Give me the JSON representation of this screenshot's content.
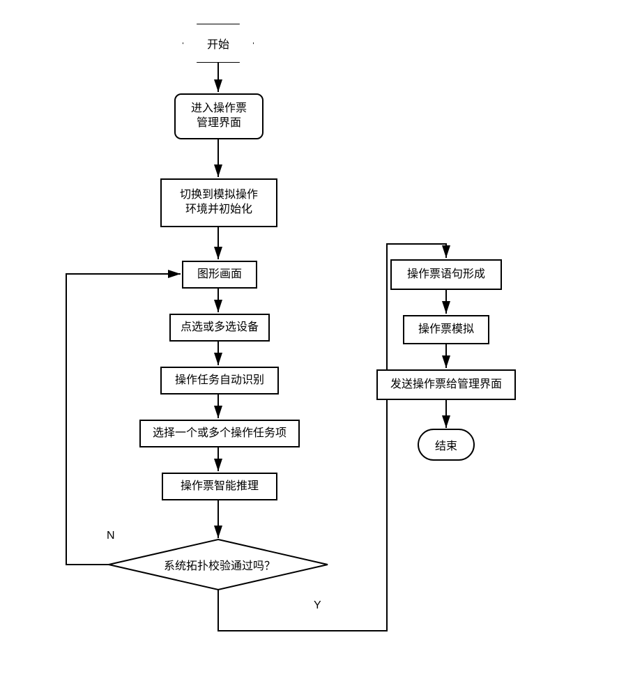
{
  "flow": {
    "start": "开始",
    "enter_mgmt": "进入操作票\n管理界面",
    "switch_sim": "切换到模拟操作\n环境并初始化",
    "graphic_screen": "图形画面",
    "select_device": "点选或多选设备",
    "auto_recognize": "操作任务自动识别",
    "choose_tasks": "选择一个或多个操作任务项",
    "reasoning": "操作票智能推理",
    "decision": "系统拓扑校验通过吗？",
    "form_sentence": "操作票语句形成",
    "simulate": "操作票模拟",
    "send_mgmt": "发送操作票给管理界面",
    "end": "结束",
    "label_no": "N",
    "label_yes": "Y"
  }
}
